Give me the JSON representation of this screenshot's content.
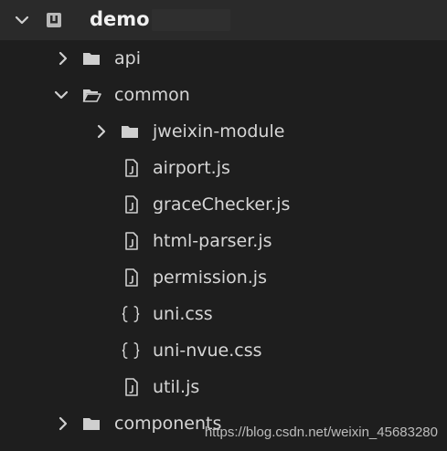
{
  "explorer": {
    "root": {
      "label": "demo",
      "expanded": true,
      "icon": "project-icon"
    },
    "items": [
      {
        "label": "api",
        "type": "folder",
        "expanded": false
      },
      {
        "label": "common",
        "type": "folder",
        "expanded": true
      },
      {
        "label": "jweixin-module",
        "type": "folder",
        "expanded": false
      },
      {
        "label": "airport.js",
        "type": "js-file"
      },
      {
        "label": "graceChecker.js",
        "type": "js-file"
      },
      {
        "label": "html-parser.js",
        "type": "js-file"
      },
      {
        "label": "permission.js",
        "type": "js-file"
      },
      {
        "label": "uni.css",
        "type": "css-file"
      },
      {
        "label": "uni-nvue.css",
        "type": "css-file"
      },
      {
        "label": "util.js",
        "type": "js-file"
      },
      {
        "label": "components",
        "type": "folder",
        "expanded": false
      }
    ]
  },
  "watermark": {
    "text": "https://blog.csdn.net/weixin_45683280"
  },
  "colors": {
    "background": "#1e1e1e",
    "root_row": "#2a2a2a",
    "text": "#d6d6d6",
    "icon": "#d0d0d0"
  }
}
